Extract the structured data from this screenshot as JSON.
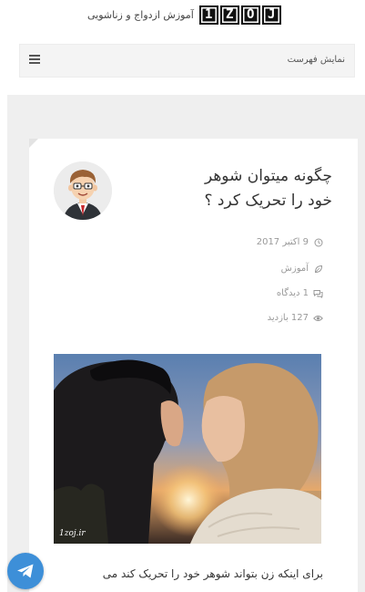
{
  "header": {
    "logo_letters": [
      "1",
      "Z",
      "O",
      "J"
    ],
    "tagline": "آموزش ازدواج و زناشویی"
  },
  "menu": {
    "label": "نمایش فهرست"
  },
  "post": {
    "title_line1": "چگونه میتوان شوهر",
    "title_line2": "خود را تحریک کرد ؟",
    "date": "9 اکتبر 2017",
    "category": "آموزش",
    "comments": "1 دیدگاه",
    "views": "127 بازدید",
    "image_caption": "1zoj.ir",
    "excerpt": "برای اینکه زن بتواند شوهر خود را تحریک کند می"
  },
  "colors": {
    "telegram_blue": "#3d8fd8",
    "card_background": "#ffffff",
    "page_background": "#efefef"
  },
  "icons": {
    "menu": "hamburger-icon",
    "date": "clock-icon",
    "category": "leaf-icon",
    "comments": "comment-icon",
    "views": "eye-icon",
    "telegram": "telegram-icon"
  }
}
